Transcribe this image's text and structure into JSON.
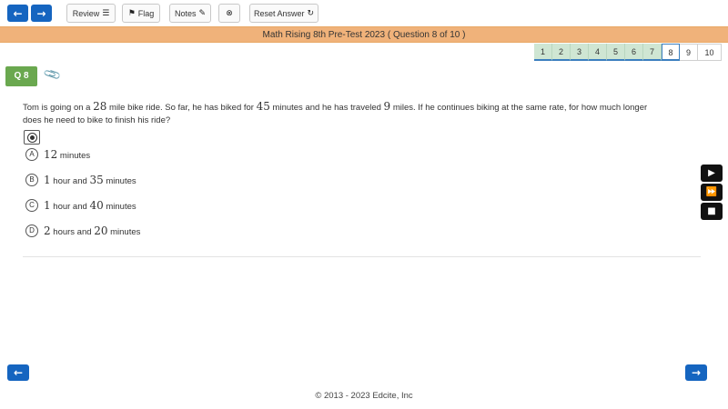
{
  "toolbar": {
    "prev_icon": "arrow-left-icon",
    "next_icon": "arrow-right-icon",
    "review_label": "Review",
    "flag_label": "Flag",
    "notes_label": "Notes",
    "reset_label": "Reset Answer",
    "accent": "#1565c0"
  },
  "title": "Math Rising 8th Pre-Test 2023 ( Question 8 of 10 )",
  "pagination": {
    "items": [
      "1",
      "2",
      "3",
      "4",
      "5",
      "6",
      "7",
      "8",
      "9",
      "10"
    ],
    "current": "8"
  },
  "question": {
    "badge": "Q 8",
    "text_parts": {
      "p1": "Tom is going on a ",
      "n1": "28",
      "p2": " mile bike ride. So far, he has biked for ",
      "n2": "45",
      "p3": " minutes and he has traveled ",
      "n3": "9",
      "p4": " miles. If he continues biking at the same rate, for how much longer does he need to bike to finish his ride?"
    }
  },
  "choices": [
    {
      "letter": "A",
      "n1": "12",
      "t1": " minutes",
      "n2": "",
      "t2": ""
    },
    {
      "letter": "B",
      "n1": "1",
      "t1": " hour and ",
      "n2": "35",
      "t2": " minutes"
    },
    {
      "letter": "C",
      "n1": "1",
      "t1": " hour and ",
      "n2": "40",
      "t2": " minutes"
    },
    {
      "letter": "D",
      "n1": "2",
      "t1": " hours and ",
      "n2": "20",
      "t2": " minutes"
    }
  ],
  "footer": "© 2013 - 2023 Edcite, Inc"
}
